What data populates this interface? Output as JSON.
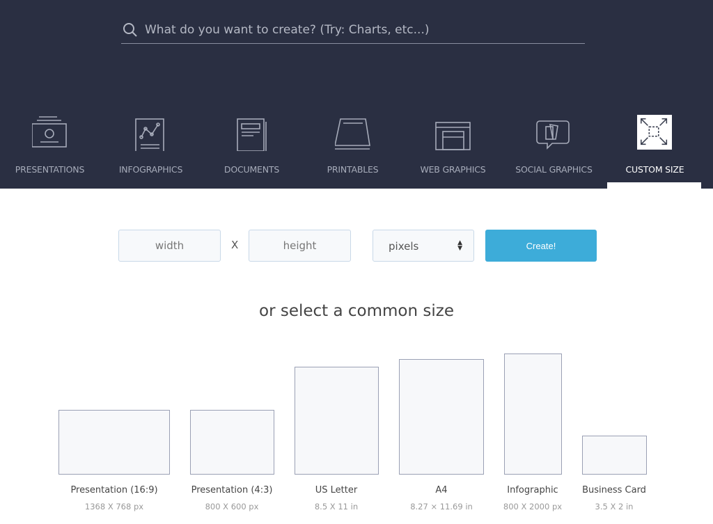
{
  "search": {
    "placeholder": "What do you want to create? (Try: Charts, etc...)"
  },
  "tabs": [
    {
      "label": "PRESENTATIONS",
      "icon": "presentation-icon"
    },
    {
      "label": "INFOGRAPHICS",
      "icon": "infographic-icon"
    },
    {
      "label": "DOCUMENTS",
      "icon": "document-icon"
    },
    {
      "label": "PRINTABLES",
      "icon": "printable-icon"
    },
    {
      "label": "WEB GRAPHICS",
      "icon": "web-graphic-icon"
    },
    {
      "label": "SOCIAL GRAPHICS",
      "icon": "social-graphic-icon"
    },
    {
      "label": "CUSTOM SIZE",
      "icon": "resize-icon",
      "active": true
    }
  ],
  "custom": {
    "width_placeholder": "width",
    "x_label": "X",
    "height_placeholder": "height",
    "unit": "pixels",
    "create_label": "Create!"
  },
  "common": {
    "heading": "or select a common size",
    "sizes": [
      {
        "name": "Presentation (16:9)",
        "dims": "1368 X 768 px"
      },
      {
        "name": "Presentation (4:3)",
        "dims": "800 X 600 px"
      },
      {
        "name": "US Letter",
        "dims": "8.5 X 11 in"
      },
      {
        "name": "A4",
        "dims": "8.27 × 11.69 in"
      },
      {
        "name": "Infographic",
        "dims": "800 X 2000 px"
      },
      {
        "name": "Business Card",
        "dims": "3.5 X 2 in"
      }
    ]
  },
  "colors": {
    "header": "#2a2f42",
    "accent": "#3dacd9"
  }
}
